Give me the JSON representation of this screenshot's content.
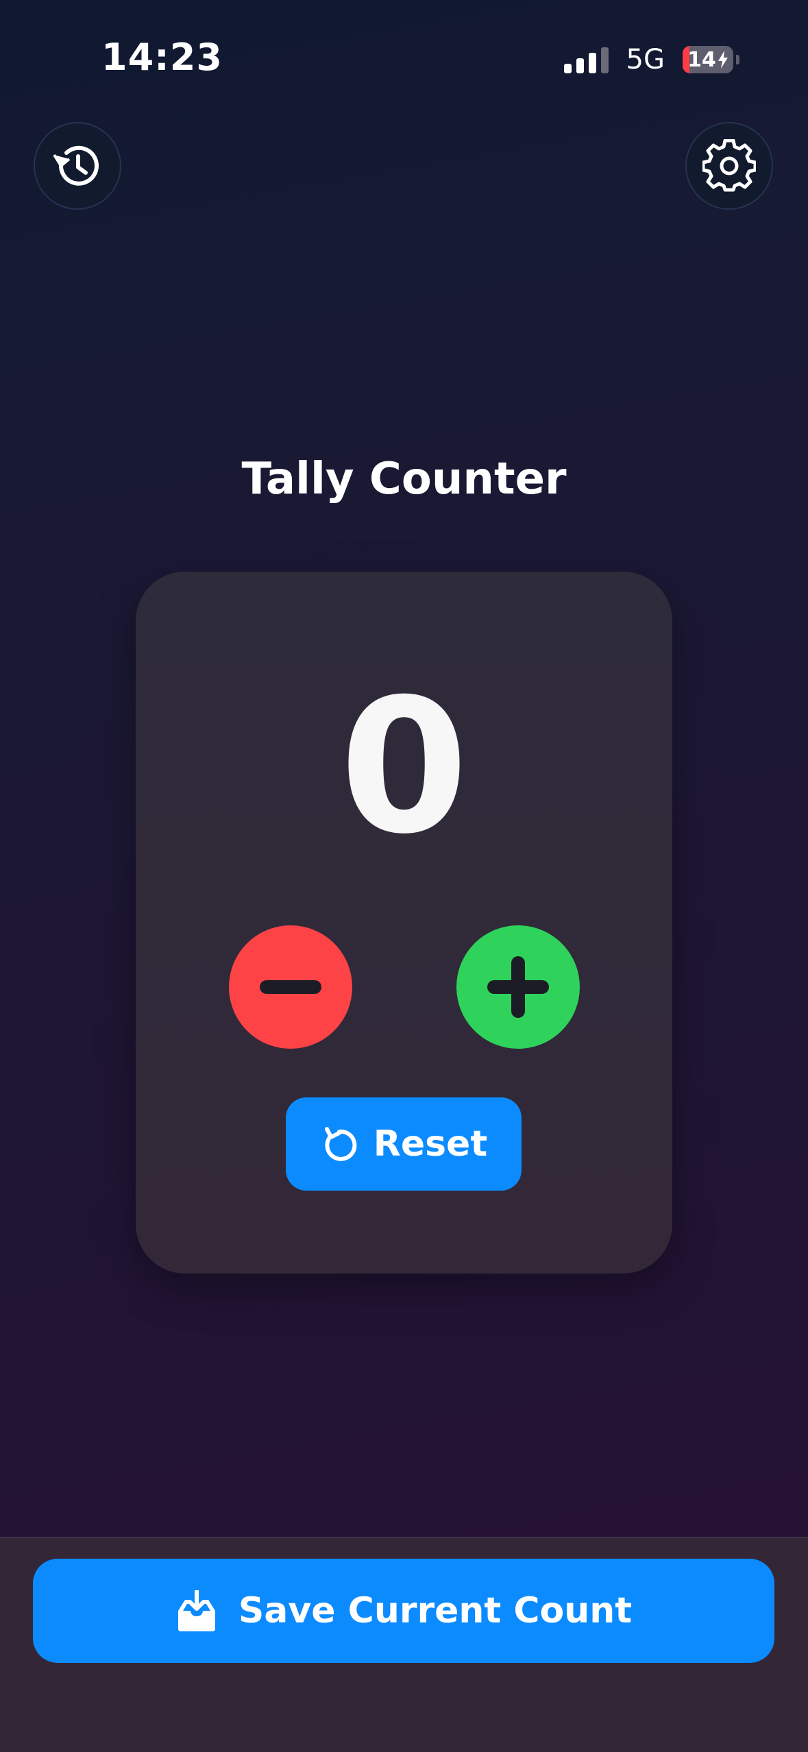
{
  "status_bar": {
    "time": "14:23",
    "network": "5G",
    "battery_level": "14",
    "battery_fraction": 0.14,
    "signal_bars_active": 3,
    "signal_bars_total": 4
  },
  "header": {
    "history_icon": "history-icon",
    "settings_icon": "gear-icon"
  },
  "main": {
    "title": "Tally Counter",
    "count": "0",
    "decrement_icon": "minus-icon",
    "increment_icon": "plus-icon",
    "reset_label": "Reset",
    "reset_icon": "reset-icon"
  },
  "footer": {
    "save_label": "Save Current Count",
    "save_icon": "tray-download-icon"
  },
  "colors": {
    "accent": "#0c8bff",
    "decrement": "#fe4347",
    "increment": "#2fd35b",
    "battery_low": "#ff3b46"
  }
}
